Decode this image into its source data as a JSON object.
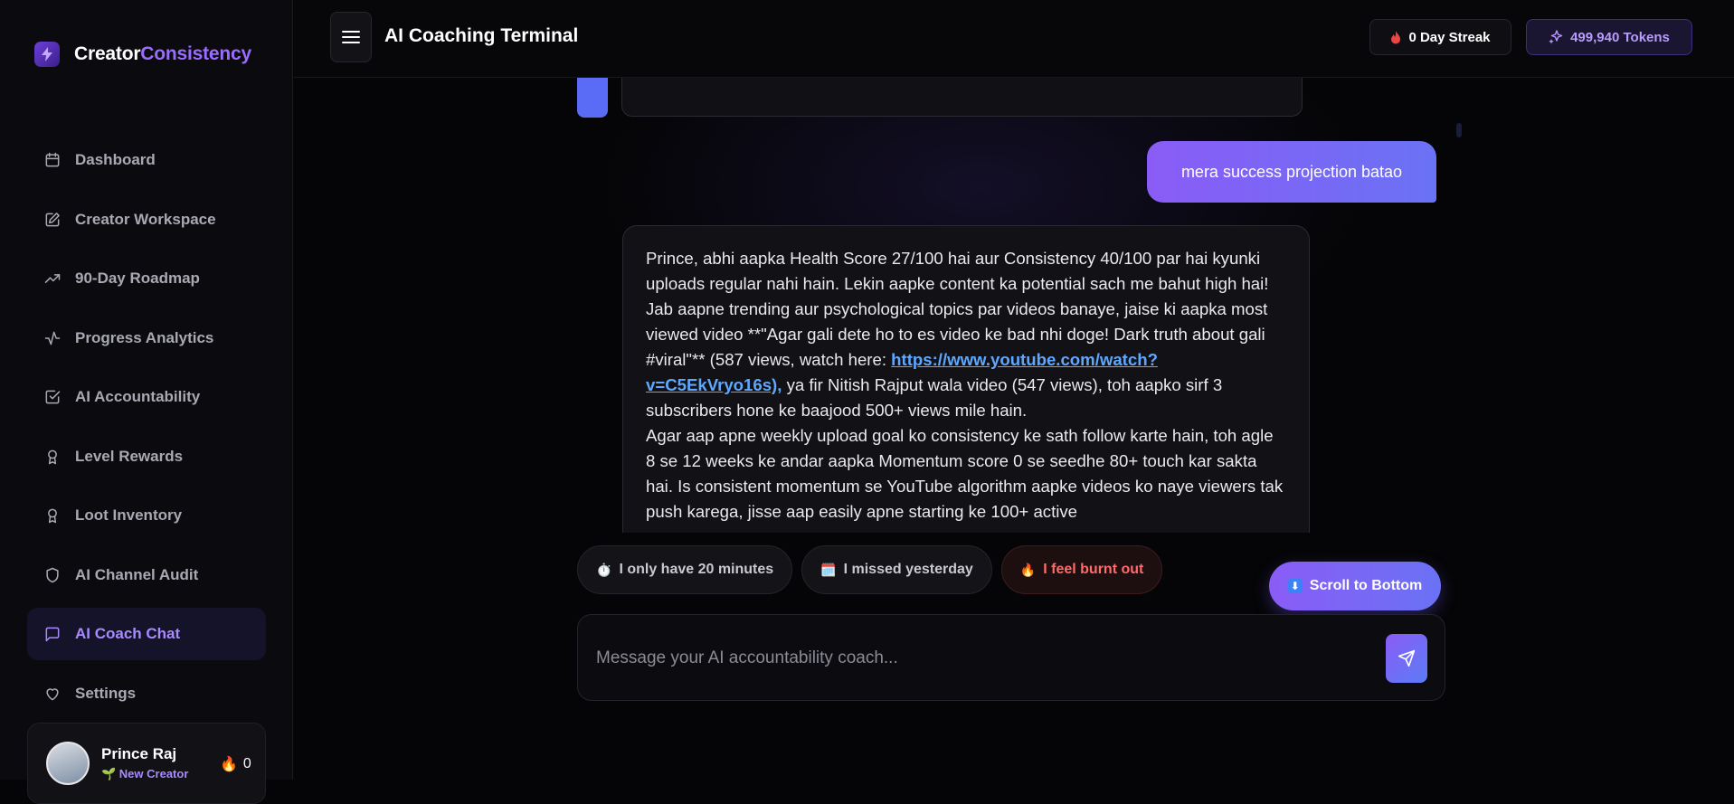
{
  "brand": {
    "name_part1": "Creator",
    "name_part2": "Consistency"
  },
  "header": {
    "title": "AI Coaching Terminal",
    "streak_label": "0 Day Streak",
    "tokens_label": "499,940 Tokens"
  },
  "sidebar": {
    "items": [
      {
        "label": "Dashboard",
        "icon": "calendar-icon"
      },
      {
        "label": "Creator Workspace",
        "icon": "edit-icon"
      },
      {
        "label": "90-Day Roadmap",
        "icon": "trending-up-icon"
      },
      {
        "label": "Progress Analytics",
        "icon": "activity-icon"
      },
      {
        "label": "AI Accountability",
        "icon": "check-square-icon"
      },
      {
        "label": "Level Rewards",
        "icon": "award-icon"
      },
      {
        "label": "Loot Inventory",
        "icon": "award-icon"
      },
      {
        "label": "AI Channel Audit",
        "icon": "shield-icon"
      },
      {
        "label": "AI Coach Chat",
        "icon": "message-square-icon",
        "active": true
      },
      {
        "label": "Settings",
        "icon": "heart-icon"
      }
    ],
    "user": {
      "name": "Prince Raj",
      "level": "🌱 New Creator",
      "streak": "0"
    }
  },
  "chat": {
    "user_message": "mera success projection batao",
    "ai_message": {
      "p1_before_link": "Prince, abhi aapka Health Score 27/100 hai aur Consistency 40/100 par hai kyunki uploads regular nahi hain. Lekin aapke content ka potential sach me bahut high hai! Jab aapne trending aur psychological topics par videos banaye, jaise ki aapka most viewed video **\"Agar gali dete ho to es video ke bad nhi doge! Dark truth about gali #viral\"** (587 views, watch here: ",
      "link": "https://www.youtube.com/watch?v=C5EkVryo16s),",
      "p1_after_link": " ya fir Nitish Rajput wala video (547 views), toh aapko sirf 3 subscribers hone ke baajood 500+ views mile hain.",
      "p2": "Agar aap apne weekly upload goal ko consistency ke sath follow karte hain, toh agle 8 se 12 weeks ke andar aapka Momentum score 0 se seedhe 80+ touch kar sakta hai. Is consistent momentum se YouTube algorithm aapke videos ko naye viewers tak push karega, jisse aap easily apne starting ke 100+ active"
    },
    "quick_replies": [
      {
        "icon": "⏱️",
        "label": "I only have 20 minutes"
      },
      {
        "icon": "🗓️",
        "label": "I missed yesterday"
      },
      {
        "icon": "🔥",
        "label": "I feel burnt out"
      }
    ],
    "scroll_button": {
      "icon": "⬇",
      "label": "Scroll to Bottom"
    },
    "composer_placeholder": "Message your AI accountability coach..."
  },
  "colors": {
    "accent": "#8a5cf6",
    "link": "#5fa8ff",
    "danger": "#ff6a6a"
  }
}
